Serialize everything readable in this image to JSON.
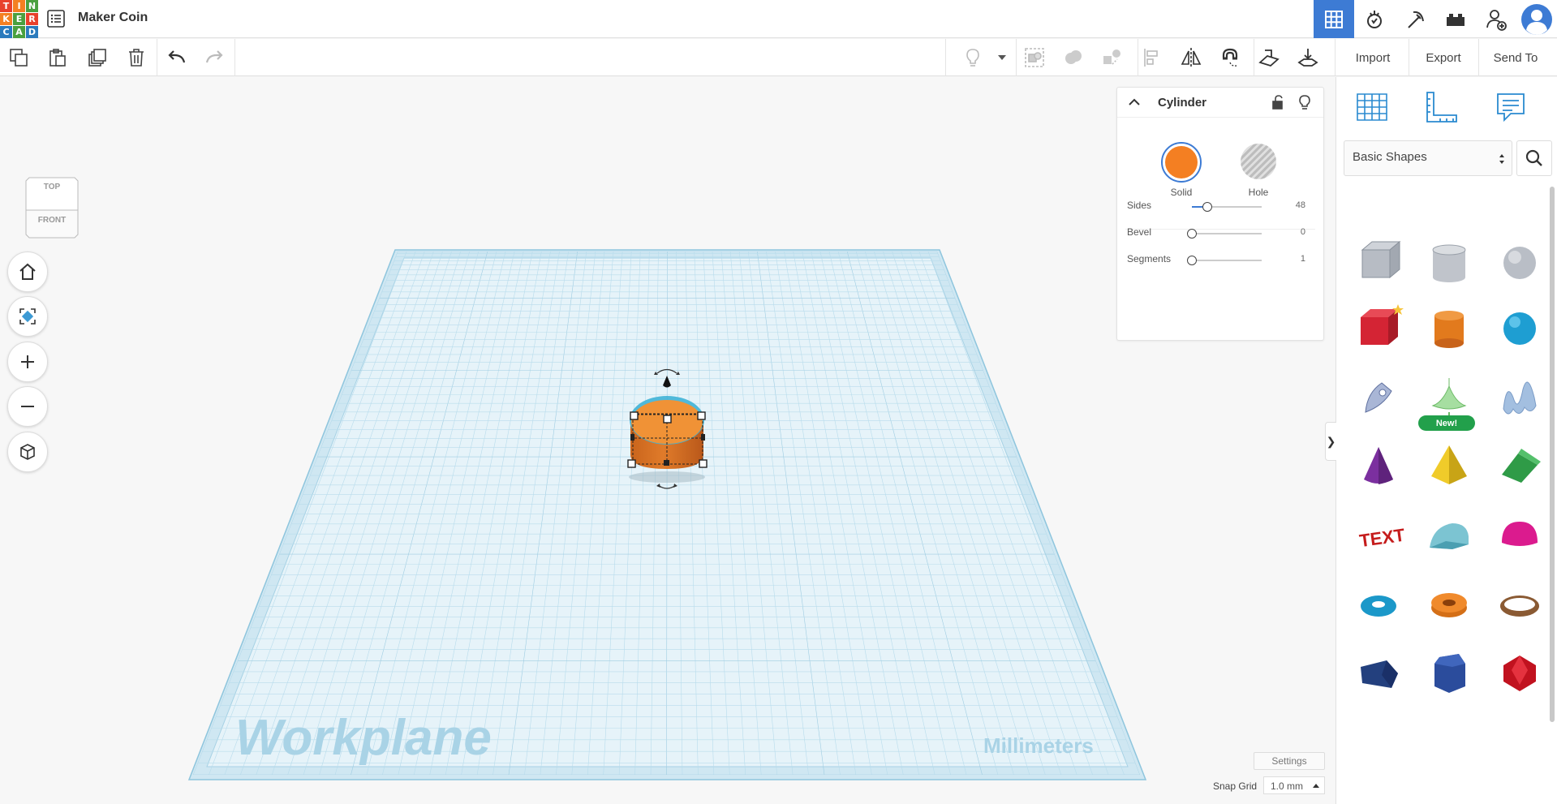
{
  "app": {
    "logo_letters": [
      "T",
      "I",
      "N",
      "K",
      "E",
      "R",
      "C",
      "A",
      "D"
    ],
    "logo_colors": [
      "#e8412c",
      "#f48022",
      "#4aa03f",
      "#f48022",
      "#4aa03f",
      "#e8412c",
      "#2b7bbd",
      "#4aa03f",
      "#2b7bbd"
    ],
    "doc_title": "Maker Coin"
  },
  "header_buttons": [
    "grid-view-icon",
    "sim-lab-icon",
    "codeblocks-icon",
    "bricks-icon",
    "add-user-icon",
    "profile-avatar-icon"
  ],
  "toolbar": {
    "import_label": "Import",
    "export_label": "Export",
    "send_to_label": "Send To"
  },
  "workplane": {
    "label": "Workplane",
    "units": "Millimeters"
  },
  "viewcube": {
    "top": "TOP",
    "front": "FRONT"
  },
  "inspector": {
    "title": "Cylinder",
    "solid_label": "Solid",
    "hole_label": "Hole",
    "solid_color": "#f47f22",
    "props": [
      {
        "name": "Sides",
        "value": "48",
        "fraction": 0.22
      },
      {
        "name": "Bevel",
        "value": "0",
        "fraction": 0.0
      },
      {
        "name": "Segments",
        "value": "1",
        "fraction": 0.0
      }
    ]
  },
  "panel": {
    "library": "Basic Shapes",
    "new_badge": "New!",
    "shapes": [
      "Box Hole",
      "Cylinder Hole",
      "Sphere Hole",
      "Box",
      "Cylinder",
      "Sphere",
      "Scribble",
      "Shape Generator",
      "Wave",
      "Cone",
      "Pyramid",
      "Roof",
      "Text",
      "Half Cylinder",
      "Paraboloid",
      "Torus",
      "Tube",
      "Ring",
      "Wedge",
      "Polygon",
      "Icosahedron"
    ]
  },
  "footer": {
    "settings_label": "Settings",
    "snap_grid_label": "Snap Grid",
    "snap_grid_value": "1.0 mm"
  }
}
